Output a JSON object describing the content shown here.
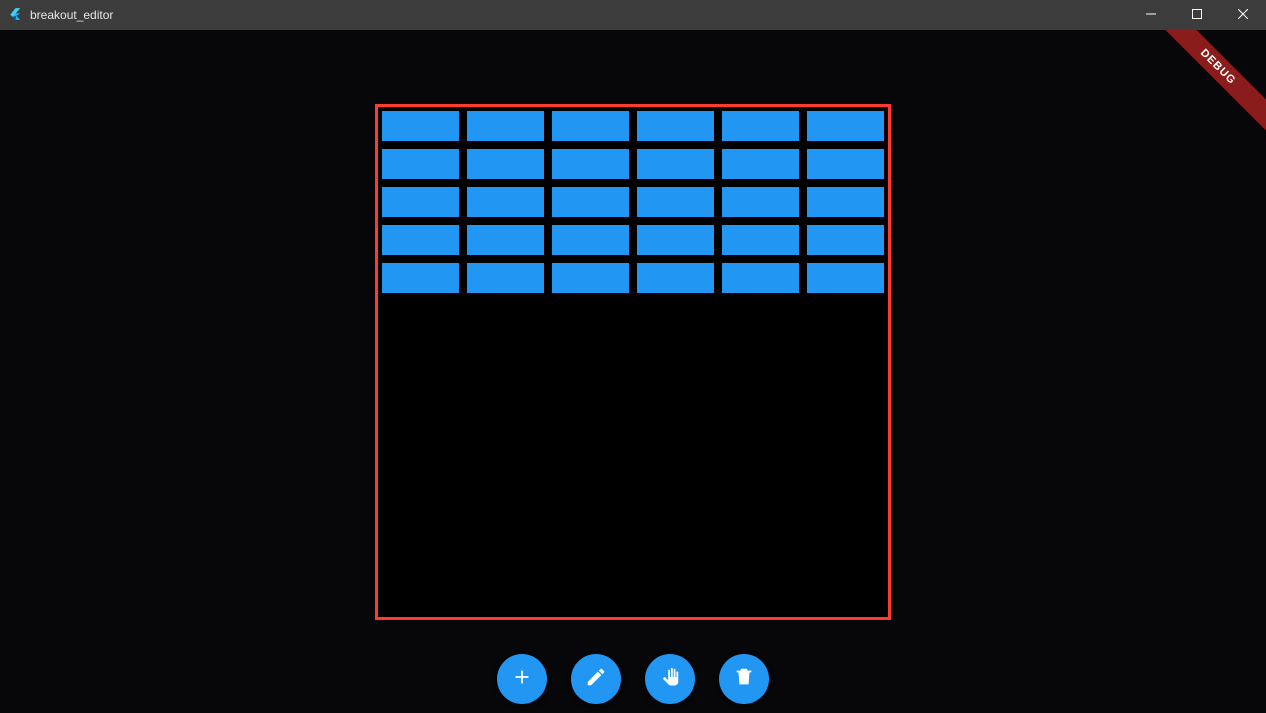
{
  "window": {
    "title": "breakout_editor"
  },
  "debug": {
    "banner": "DEBUG"
  },
  "colors": {
    "accent": "#2196f3",
    "canvas_border": "#ff3b30",
    "titlebar_bg": "#3c3c3c",
    "client_bg": "#07070a",
    "brick": "#2196f3"
  },
  "toolbar": {
    "buttons": [
      {
        "name": "add-button",
        "icon": "plus-icon"
      },
      {
        "name": "edit-button",
        "icon": "pencil-icon"
      },
      {
        "name": "pan-button",
        "icon": "hand-icon"
      },
      {
        "name": "delete-button",
        "icon": "trash-icon"
      }
    ]
  },
  "level": {
    "columns": 6,
    "rows": 5,
    "bricks": [
      [
        1,
        1,
        1,
        1,
        1,
        1
      ],
      [
        1,
        1,
        1,
        1,
        1,
        1
      ],
      [
        1,
        1,
        1,
        1,
        1,
        1
      ],
      [
        1,
        1,
        1,
        1,
        1,
        1
      ],
      [
        1,
        1,
        1,
        1,
        1,
        1
      ]
    ]
  }
}
